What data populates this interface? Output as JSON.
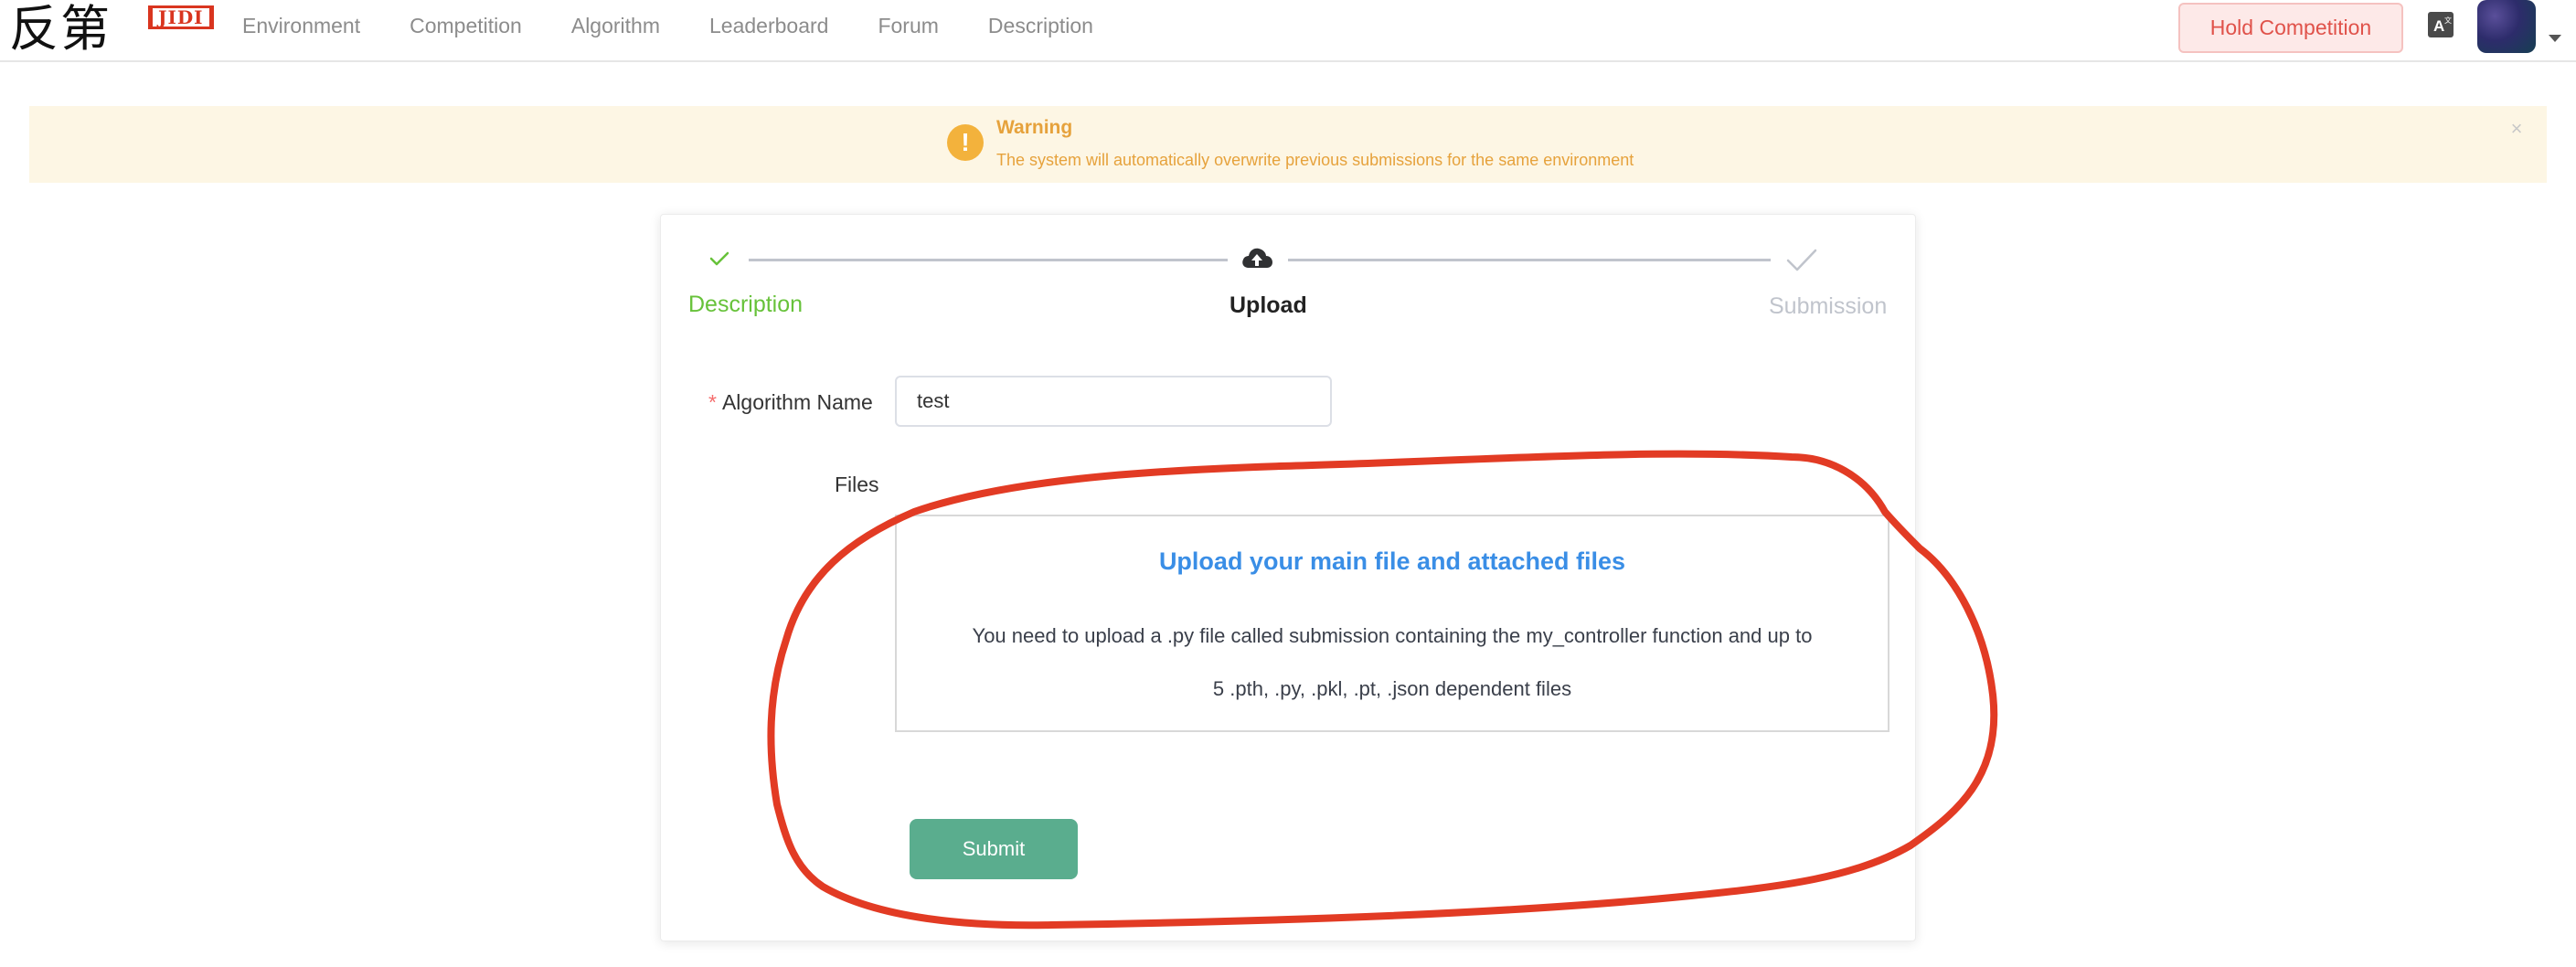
{
  "header": {
    "logo_text": "反第",
    "logo_badge": "JIDI",
    "nav": [
      "Environment",
      "Competition",
      "Algorithm",
      "Leaderboard",
      "Forum",
      "Description"
    ],
    "hold_button": "Hold Competition",
    "language_icon": "translate-icon",
    "avatar_icon": "avatar"
  },
  "warning": {
    "title": "Warning",
    "message": "The system will automatically overwrite previous submissions for the same environment",
    "close_symbol": "×",
    "icon_symbol": "!"
  },
  "steps": [
    {
      "label": "Description",
      "state": "done"
    },
    {
      "label": "Upload",
      "state": "active"
    },
    {
      "label": "Submission",
      "state": "pending"
    }
  ],
  "form": {
    "required_mark": "*",
    "name_label": "Algorithm Name",
    "name_value": "test",
    "files_label": "Files",
    "upload_title": "Upload your main file and attached files",
    "upload_line1": "You need to upload a .py file called submission containing the my_controller function and up to",
    "upload_line2": "5 .pth, .py, .pkl, .pt, .json dependent files",
    "submit_label": "Submit"
  },
  "colors": {
    "accent_green": "#5aad8e",
    "done_green": "#67c23a",
    "warning_orange": "#e6a23c",
    "upload_blue": "#3a8ee6",
    "annotation_red": "#e23b24"
  }
}
